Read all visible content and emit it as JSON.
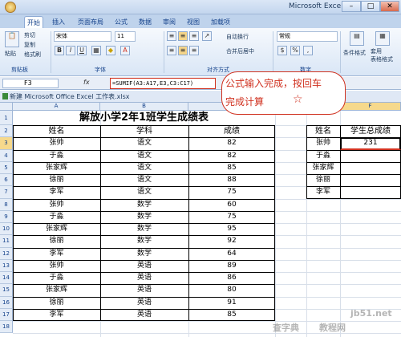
{
  "window": {
    "title": "Microsoft Excel"
  },
  "ribbon": {
    "tabs": [
      "开始",
      "插入",
      "页面布局",
      "公式",
      "数据",
      "审阅",
      "视图",
      "加载项"
    ],
    "clipboard": {
      "paste": "粘贴",
      "cut": "剪切",
      "copy": "复制",
      "format_painter": "格式刷"
    },
    "font": {
      "name": "宋体",
      "size": "11"
    },
    "alignment": {
      "wrap": "自动换行",
      "merge": "合并后居中"
    },
    "number": {
      "format": "常规"
    },
    "styles": {
      "conditional": "条件格式",
      "table": "套用\n表格格式"
    },
    "groups": [
      "剪贴板",
      "字体",
      "对齐方式",
      "数字"
    ]
  },
  "formula_bar": {
    "name_box": "F3",
    "fx": "fx",
    "formula": "=SUMIF(A3:A17,E3,C3:C17)"
  },
  "workbook": {
    "name": "新建 Microsoft Office Excel 工作表.xlsx"
  },
  "columns": [
    "A",
    "B",
    "C",
    "D",
    "E",
    "F"
  ],
  "rows": [
    "1",
    "2",
    "3",
    "4",
    "5",
    "6",
    "7",
    "8",
    "9",
    "10",
    "11",
    "12",
    "13",
    "14",
    "15",
    "16",
    "17",
    "18"
  ],
  "table": {
    "title": "解放小学2年1班学生成绩表",
    "headers": [
      "姓名",
      "学科",
      "成绩"
    ],
    "data": [
      [
        "张帅",
        "语文",
        "82"
      ],
      [
        "于淼",
        "语文",
        "82"
      ],
      [
        "张家辉",
        "语文",
        "85"
      ],
      [
        "徐丽",
        "语文",
        "88"
      ],
      [
        "李军",
        "语文",
        "75"
      ],
      [
        "张帅",
        "数学",
        "60"
      ],
      [
        "于淼",
        "数学",
        "75"
      ],
      [
        "张家辉",
        "数学",
        "95"
      ],
      [
        "徐丽",
        "数学",
        "92"
      ],
      [
        "李军",
        "数学",
        "64"
      ],
      [
        "张帅",
        "英语",
        "89"
      ],
      [
        "于淼",
        "英语",
        "86"
      ],
      [
        "张家辉",
        "英语",
        "80"
      ],
      [
        "徐丽",
        "英语",
        "91"
      ],
      [
        "李军",
        "英语",
        "85"
      ]
    ]
  },
  "summary": {
    "headers": [
      "姓名",
      "学生总成绩"
    ],
    "names": [
      "张帅",
      "于淼",
      "张家辉",
      "徐丽",
      "李军"
    ],
    "totals": [
      "231",
      "",
      "",
      "",
      ""
    ]
  },
  "callout": {
    "line1": "公式输入完成，按回车",
    "line2": "完成计算",
    "star": "☆"
  },
  "watermarks": [
    "jb51.net",
    "查字典",
    "教程网"
  ],
  "colors": {
    "accent": "#d0311f",
    "ribbon_text": "#15428b"
  }
}
